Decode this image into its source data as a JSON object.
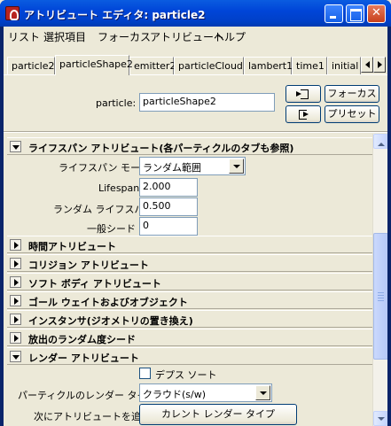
{
  "window": {
    "title": "アトリビュート エディタ: particle2"
  },
  "menu": [
    "リスト",
    "選択項目",
    "フォーカス",
    "アトリビュート",
    "ヘルプ"
  ],
  "tabs": [
    "particle2",
    "particleShape2",
    "emitter2",
    "particleCloud1",
    "lambert1",
    "time1",
    "initial"
  ],
  "node": {
    "label": "particle:",
    "value": "particleShape2",
    "focus_label": "フォーカス",
    "preset_label": "プリセット"
  },
  "lifespan_section": {
    "title": "ライフスパン アトリビュート(各パーティクルのタブも参照)",
    "mode_label": "ライフスパン モード",
    "mode_value": "ランダム範囲",
    "lifespan_label": "Lifespan",
    "lifespan_value": "2.000",
    "random_label": "ランダム ライフスパン",
    "random_value": "0.500",
    "seed_label": "一般シード",
    "seed_value": "0"
  },
  "collapsed_sections": [
    "時間アトリビュート",
    "コリジョン アトリビュート",
    "ソフト ボディ アトリビュート",
    "ゴール ウェイトおよびオブジェクト",
    "インスタンサ(ジオメトリの置き換え)",
    "放出のランダム度シード"
  ],
  "render_section": {
    "title": "レンダー アトリビュート",
    "depth_sort_label": "デプス ソート",
    "depth_sort_checked": false,
    "render_type_label": "パーティクルのレンダー タイプ",
    "render_type_value": "クラウド(s/w)",
    "add_attr_label": "次にアトリビュートを追加",
    "current_render_type_label": "カレント レンダー タイプ"
  },
  "colors": {
    "title_bar": "#0054e3",
    "face": "#ece9d8",
    "field_border": "#7f9db9"
  }
}
